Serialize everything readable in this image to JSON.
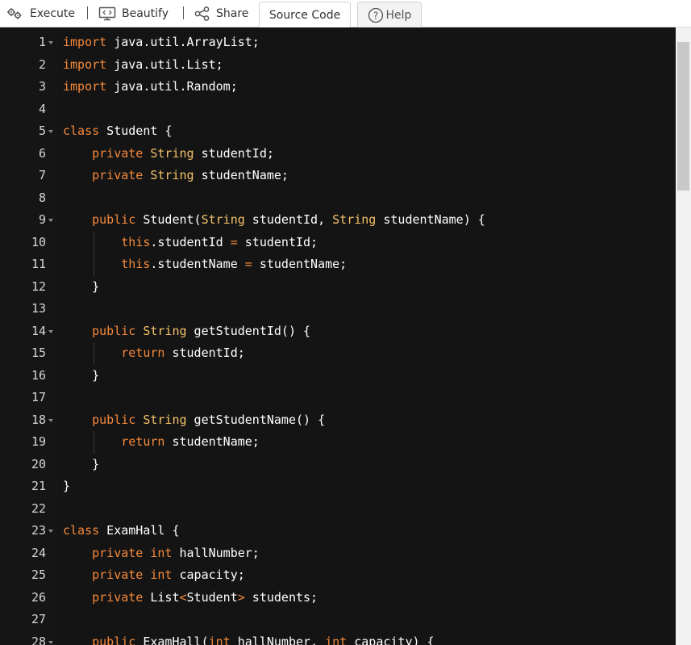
{
  "toolbar": {
    "execute_label": "Execute",
    "beautify_label": "Beautify",
    "share_label": "Share",
    "tabs": [
      {
        "label": "Source Code",
        "active": true
      },
      {
        "label": "Help",
        "active": false
      }
    ]
  },
  "colors": {
    "editor_bg": "#141414",
    "keyword": "#f58a3c",
    "type": "#f4c16a",
    "plain": "#ffffff",
    "line_number": "#d6d6d6"
  },
  "editor": {
    "lines": [
      {
        "n": "1",
        "fold": true,
        "tokens": [
          [
            "kw",
            "import"
          ],
          [
            "p",
            " java.util.ArrayList;"
          ]
        ]
      },
      {
        "n": "2",
        "fold": false,
        "tokens": [
          [
            "kw",
            "import"
          ],
          [
            "p",
            " java.util.List;"
          ]
        ]
      },
      {
        "n": "3",
        "fold": false,
        "tokens": [
          [
            "kw",
            "import"
          ],
          [
            "p",
            " java.util.Random;"
          ]
        ]
      },
      {
        "n": "4",
        "fold": false,
        "tokens": []
      },
      {
        "n": "5",
        "fold": true,
        "tokens": [
          [
            "kw",
            "class"
          ],
          [
            "p",
            " Student {"
          ]
        ]
      },
      {
        "n": "6",
        "fold": false,
        "tokens": [
          [
            "p",
            "    "
          ],
          [
            "kw",
            "private"
          ],
          [
            "p",
            " "
          ],
          [
            "ty",
            "String"
          ],
          [
            "p",
            " studentId;"
          ]
        ]
      },
      {
        "n": "7",
        "fold": false,
        "tokens": [
          [
            "p",
            "    "
          ],
          [
            "kw",
            "private"
          ],
          [
            "p",
            " "
          ],
          [
            "ty",
            "String"
          ],
          [
            "p",
            " studentName;"
          ]
        ]
      },
      {
        "n": "8",
        "fold": false,
        "tokens": []
      },
      {
        "n": "9",
        "fold": true,
        "tokens": [
          [
            "p",
            "    "
          ],
          [
            "kw",
            "public"
          ],
          [
            "p",
            " Student("
          ],
          [
            "ty",
            "String"
          ],
          [
            "p",
            " studentId, "
          ],
          [
            "ty",
            "String"
          ],
          [
            "p",
            " studentName) {"
          ]
        ]
      },
      {
        "n": "10",
        "fold": false,
        "tokens": [
          [
            "p",
            "        "
          ],
          [
            "kw",
            "this"
          ],
          [
            "p",
            ".studentId "
          ],
          [
            "op",
            "="
          ],
          [
            "p",
            " studentId;"
          ]
        ]
      },
      {
        "n": "11",
        "fold": false,
        "tokens": [
          [
            "p",
            "        "
          ],
          [
            "kw",
            "this"
          ],
          [
            "p",
            ".studentName "
          ],
          [
            "op",
            "="
          ],
          [
            "p",
            " studentName;"
          ]
        ]
      },
      {
        "n": "12",
        "fold": false,
        "tokens": [
          [
            "p",
            "    }"
          ]
        ]
      },
      {
        "n": "13",
        "fold": false,
        "tokens": []
      },
      {
        "n": "14",
        "fold": true,
        "tokens": [
          [
            "p",
            "    "
          ],
          [
            "kw",
            "public"
          ],
          [
            "p",
            " "
          ],
          [
            "ty",
            "String"
          ],
          [
            "p",
            " getStudentId() {"
          ]
        ]
      },
      {
        "n": "15",
        "fold": false,
        "tokens": [
          [
            "p",
            "        "
          ],
          [
            "kw",
            "return"
          ],
          [
            "p",
            " studentId;"
          ]
        ]
      },
      {
        "n": "16",
        "fold": false,
        "tokens": [
          [
            "p",
            "    }"
          ]
        ]
      },
      {
        "n": "17",
        "fold": false,
        "tokens": []
      },
      {
        "n": "18",
        "fold": true,
        "tokens": [
          [
            "p",
            "    "
          ],
          [
            "kw",
            "public"
          ],
          [
            "p",
            " "
          ],
          [
            "ty",
            "String"
          ],
          [
            "p",
            " getStudentName() {"
          ]
        ]
      },
      {
        "n": "19",
        "fold": false,
        "tokens": [
          [
            "p",
            "        "
          ],
          [
            "kw",
            "return"
          ],
          [
            "p",
            " studentName;"
          ]
        ]
      },
      {
        "n": "20",
        "fold": false,
        "tokens": [
          [
            "p",
            "    }"
          ]
        ]
      },
      {
        "n": "21",
        "fold": false,
        "tokens": [
          [
            "p",
            "}"
          ]
        ]
      },
      {
        "n": "22",
        "fold": false,
        "tokens": []
      },
      {
        "n": "23",
        "fold": true,
        "tokens": [
          [
            "kw",
            "class"
          ],
          [
            "p",
            " ExamHall {"
          ]
        ]
      },
      {
        "n": "24",
        "fold": false,
        "tokens": [
          [
            "p",
            "    "
          ],
          [
            "kw",
            "private"
          ],
          [
            "p",
            " "
          ],
          [
            "kw",
            "int"
          ],
          [
            "p",
            " hallNumber;"
          ]
        ]
      },
      {
        "n": "25",
        "fold": false,
        "tokens": [
          [
            "p",
            "    "
          ],
          [
            "kw",
            "private"
          ],
          [
            "p",
            " "
          ],
          [
            "kw",
            "int"
          ],
          [
            "p",
            " capacity;"
          ]
        ]
      },
      {
        "n": "26",
        "fold": false,
        "tokens": [
          [
            "p",
            "    "
          ],
          [
            "kw",
            "private"
          ],
          [
            "p",
            " List"
          ],
          [
            "op",
            "<"
          ],
          [
            "p",
            "Student"
          ],
          [
            "op",
            ">"
          ],
          [
            "p",
            " students;"
          ]
        ]
      },
      {
        "n": "27",
        "fold": false,
        "tokens": []
      },
      {
        "n": "28",
        "fold": true,
        "tokens": [
          [
            "p",
            "    "
          ],
          [
            "kw",
            "public"
          ],
          [
            "p",
            " ExamHall("
          ],
          [
            "kw",
            "int"
          ],
          [
            "p",
            " hallNumber, "
          ],
          [
            "kw",
            "int"
          ],
          [
            "p",
            " capacity) {"
          ]
        ]
      }
    ]
  }
}
